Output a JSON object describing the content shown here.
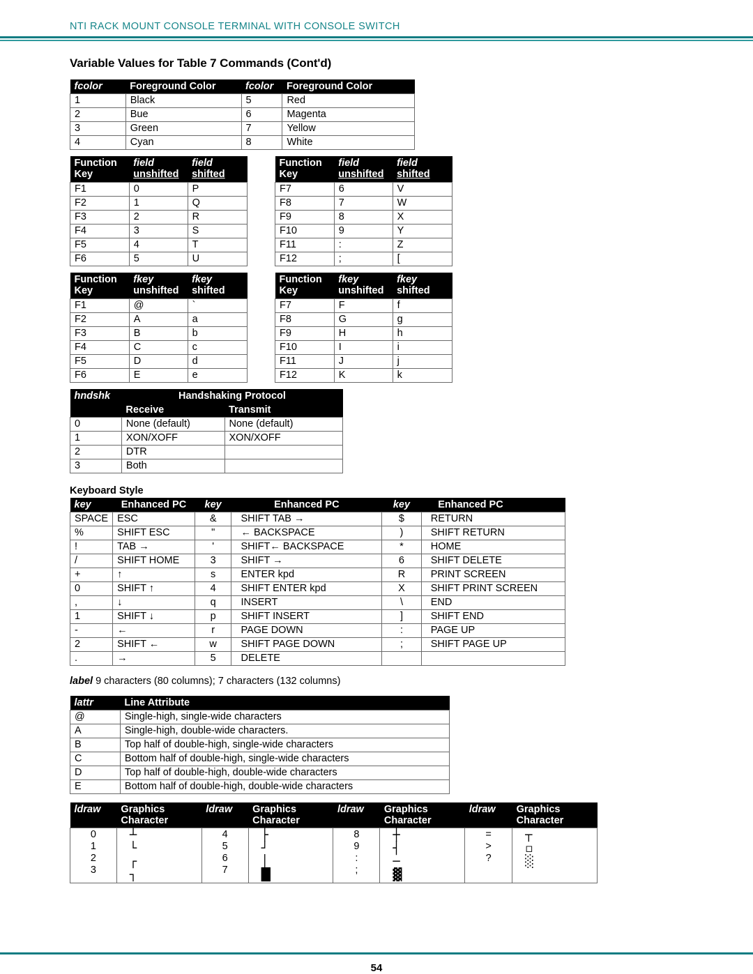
{
  "header": {
    "running_title": "NTI RACK MOUNT CONSOLE TERMINAL WITH CONSOLE SWITCH",
    "accent_color": "#0f7c82"
  },
  "doc_title": "Variable Values for Table 7 Commands (Cont'd)",
  "fcolor_table": {
    "headers": [
      "fcolor",
      "Foreground Color",
      "fcolor",
      "Foreground Color"
    ],
    "rows": [
      [
        "1",
        "Black",
        "5",
        "Red"
      ],
      [
        "2",
        "Bue",
        "6",
        "Magenta"
      ],
      [
        "3",
        "Green",
        "7",
        "Yellow"
      ],
      [
        "4",
        "Cyan",
        "8",
        "White"
      ]
    ]
  },
  "field_table_left": {
    "headers": {
      "col1_line1": "Function",
      "col1_line2": "Key",
      "col2_line1": "field",
      "col2_line2": "unshifted",
      "col3_line1": "field",
      "col3_line2": "shifted"
    },
    "rows": [
      [
        "F1",
        "0",
        "P"
      ],
      [
        "F2",
        "1",
        "Q"
      ],
      [
        "F3",
        "2",
        "R"
      ],
      [
        "F4",
        "3",
        "S"
      ],
      [
        "F5",
        "4",
        "T"
      ],
      [
        "F6",
        "5",
        "U"
      ]
    ]
  },
  "field_table_right": {
    "headers": {
      "col1_line1": "Function",
      "col1_line2": "Key",
      "col2_line1": "field",
      "col2_line2": "unshifted",
      "col3_line1": "field",
      "col3_line2": "shifted"
    },
    "rows": [
      [
        "F7",
        "6",
        "V"
      ],
      [
        "F8",
        "7",
        "W"
      ],
      [
        "F9",
        "8",
        "X"
      ],
      [
        "F10",
        "9",
        "Y"
      ],
      [
        "F11",
        ":",
        "Z"
      ],
      [
        "F12",
        ";",
        "["
      ]
    ]
  },
  "fkey_table_left": {
    "headers": {
      "col1_line1": "Function",
      "col1_line2": "Key",
      "col2_line1": "fkey",
      "col2_line2": "unshifted",
      "col3_line1": "fkey",
      "col3_line2": "shifted"
    },
    "rows": [
      [
        "F1",
        "@",
        "`"
      ],
      [
        "F2",
        "A",
        "a"
      ],
      [
        "F3",
        "B",
        "b"
      ],
      [
        "F4",
        "C",
        "c"
      ],
      [
        "F5",
        "D",
        "d"
      ],
      [
        "F6",
        "E",
        "e"
      ]
    ]
  },
  "fkey_table_right": {
    "headers": {
      "col1_line1": "Function",
      "col1_line2": "Key",
      "col2_line1": "fkey",
      "col2_line2": "unshifted",
      "col3_line1": "fkey",
      "col3_line2": "shifted"
    },
    "rows": [
      [
        "F7",
        "F",
        "f"
      ],
      [
        "F8",
        "G",
        "g"
      ],
      [
        "F9",
        "H",
        "h"
      ],
      [
        "F10",
        "I",
        "i"
      ],
      [
        "F11",
        "J",
        "j"
      ],
      [
        "F12",
        "K",
        "k"
      ]
    ]
  },
  "hndshk_table": {
    "col1_header": "hndshk",
    "span_header": "Handshaking Protocol",
    "sub_headers": [
      "Receive",
      "Transmit"
    ],
    "rows": [
      [
        "0",
        "None (default)",
        "None (default)"
      ],
      [
        "1",
        "XON/XOFF",
        "XON/XOFF"
      ],
      [
        "2",
        "DTR",
        ""
      ],
      [
        "3",
        "Both",
        ""
      ]
    ]
  },
  "keyboard_style": {
    "caption": "Keyboard Style",
    "headers": [
      "key",
      "Enhanced PC",
      "key",
      "Enhanced PC",
      "key",
      "Enhanced PC"
    ],
    "rows": [
      [
        "SPACE",
        "ESC",
        "&",
        "SHIFT TAB →",
        "$",
        "RETURN"
      ],
      [
        "%",
        "SHIFT ESC",
        "\"",
        "← BACKSPACE",
        ")",
        "SHIFT RETURN"
      ],
      [
        "!",
        "TAB →",
        "'",
        "SHIFT← BACKSPACE",
        "*",
        "HOME"
      ],
      [
        "/",
        "SHIFT HOME",
        "3",
        "SHIFT →",
        "6",
        "SHIFT DELETE"
      ],
      [
        "+",
        "↑",
        "s",
        "ENTER kpd",
        "R",
        "PRINT SCREEN"
      ],
      [
        "0",
        "SHIFT ↑",
        "4",
        "SHIFT ENTER kpd",
        "X",
        "SHIFT PRINT SCREEN"
      ],
      [
        ",",
        "↓",
        "q",
        "INSERT",
        "\\",
        "END"
      ],
      [
        "1",
        "SHIFT ↓",
        "p",
        "SHIFT INSERT",
        "]",
        "SHIFT END"
      ],
      [
        "-",
        "←",
        "r",
        "PAGE DOWN",
        ":",
        "PAGE UP"
      ],
      [
        "2",
        "SHIFT ←",
        "w",
        "SHIFT PAGE DOWN",
        ";",
        "SHIFT PAGE UP"
      ],
      [
        ".",
        "→",
        "5",
        "DELETE",
        "",
        ""
      ]
    ]
  },
  "label_note": {
    "term": "label",
    "text": " 9 characters (80 columns); 7 characters (132 columns)"
  },
  "lattr_table": {
    "headers": [
      "lattr",
      "Line Attribute"
    ],
    "rows": [
      [
        "@",
        "Single-high, single-wide characters"
      ],
      [
        "A",
        "Single-high, double-wide characters."
      ],
      [
        "B",
        "Top half of double-high, single-wide characters"
      ],
      [
        "C",
        "Bottom half of double-high, single-wide characters"
      ],
      [
        "D",
        "Top half of double-high, double-wide characters"
      ],
      [
        "E",
        "Bottom half of double-high, double-wide characters"
      ]
    ]
  },
  "ldraw_table": {
    "headers": [
      {
        "code": "ldraw",
        "char_line1": "Graphics",
        "char_line2": "Character"
      },
      {
        "code": "ldraw",
        "char_line1": "Graphics",
        "char_line2": "Character"
      },
      {
        "code": "ldraw",
        "char_line1": "Graphics",
        "char_line2": "Character"
      },
      {
        "code": "ldraw",
        "char_line1": "Graphics",
        "char_line2": "Character"
      }
    ],
    "groups": [
      {
        "codes": [
          "0",
          "1",
          "2",
          "3"
        ],
        "glyphs": [
          "┴",
          "└",
          "┌",
          "┐"
        ]
      },
      {
        "codes": [
          "4",
          "5",
          "6",
          "7"
        ],
        "glyphs": [
          "├",
          "┘",
          "│",
          "█"
        ]
      },
      {
        "codes": [
          "8",
          "9",
          ":",
          ";"
        ],
        "glyphs": [
          "┼",
          "┤",
          "─",
          "▓"
        ]
      },
      {
        "codes": [
          "=",
          ">",
          "?",
          ""
        ],
        "glyphs": [
          "┬",
          "▫",
          "░",
          ""
        ]
      }
    ]
  },
  "footer": {
    "page_number": "54"
  }
}
